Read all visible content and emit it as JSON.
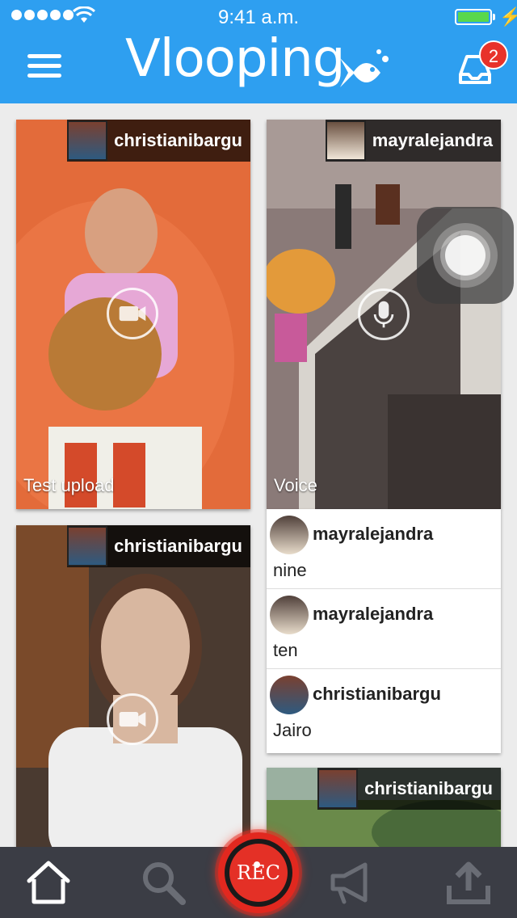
{
  "status_bar": {
    "time": "9:41 a.m."
  },
  "header": {
    "logo_text": "Vlooping",
    "notification_count": "2"
  },
  "feed": {
    "cards": [
      {
        "user": "christianibargu",
        "caption": "Test upload",
        "media_type": "video"
      },
      {
        "user": "mayralejandra",
        "caption": "Voice",
        "media_type": "audio"
      },
      {
        "user": "christianibargu",
        "caption": "",
        "media_type": "video"
      },
      {
        "user": "christianibargu",
        "caption": "",
        "media_type": "video"
      }
    ],
    "comments": [
      {
        "user": "mayralejandra",
        "text": "nine"
      },
      {
        "user": "mayralejandra",
        "text": "ten"
      },
      {
        "user": "christianibargu",
        "text": "Jairo"
      }
    ]
  },
  "tabbar": {
    "rec_label": "REC",
    "items": [
      "home-icon",
      "search-icon",
      "rec-button",
      "megaphone-icon",
      "upload-icon"
    ]
  },
  "colors": {
    "header_bg": "#2e9ff0",
    "tabbar_bg": "#3b3d45",
    "rec_red": "#e43026",
    "badge_red": "#e8322a"
  }
}
